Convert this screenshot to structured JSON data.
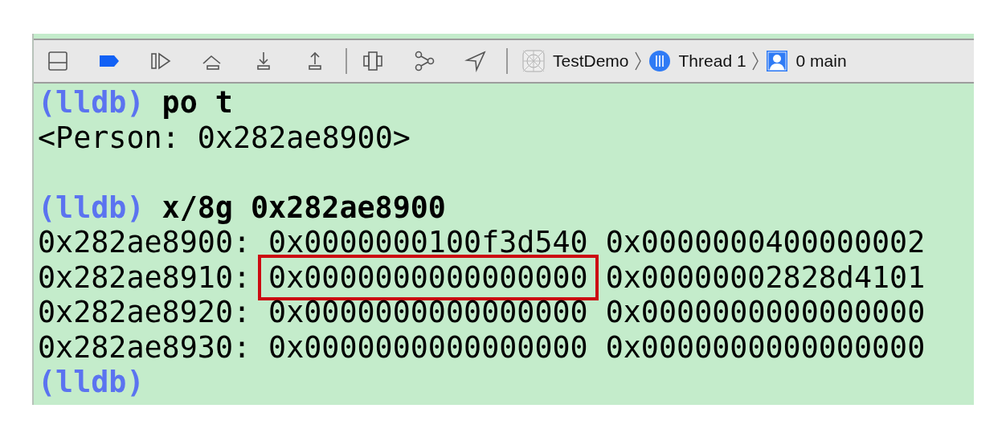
{
  "toolbar": {
    "breakpoints_active": true,
    "breadcrumbs": [
      {
        "kind": "app",
        "label": "TestDemo"
      },
      {
        "kind": "thread",
        "label": "Thread 1"
      },
      {
        "kind": "frame",
        "label": "0 main"
      }
    ]
  },
  "console": {
    "lines": [
      {
        "kind": "prompt",
        "prompt": "(lldb)",
        "command": "po t"
      },
      {
        "kind": "output",
        "text": "<Person: 0x282ae8900>"
      },
      {
        "kind": "blank"
      },
      {
        "kind": "prompt",
        "prompt": "(lldb)",
        "command": "x/8g 0x282ae8900"
      },
      {
        "kind": "memory",
        "address": "0x282ae8900:",
        "values": [
          {
            "text": "0x0000000100f3d540",
            "highlighted": false
          },
          {
            "text": "0x0000000400000002",
            "highlighted": false
          }
        ]
      },
      {
        "kind": "memory",
        "address": "0x282ae8910:",
        "values": [
          {
            "text": "0x0000000000000000",
            "highlighted": true
          },
          {
            "text": "0x00000002828d4101",
            "highlighted": false
          }
        ]
      },
      {
        "kind": "memory",
        "address": "0x282ae8920:",
        "values": [
          {
            "text": "0x0000000000000000",
            "highlighted": false
          },
          {
            "text": "0x0000000000000000",
            "highlighted": false
          }
        ]
      },
      {
        "kind": "memory",
        "address": "0x282ae8930:",
        "values": [
          {
            "text": "0x0000000000000000",
            "highlighted": false
          },
          {
            "text": "0x0000000000000000",
            "highlighted": false
          }
        ]
      },
      {
        "kind": "prompt",
        "prompt": "(lldb)"
      }
    ]
  }
}
